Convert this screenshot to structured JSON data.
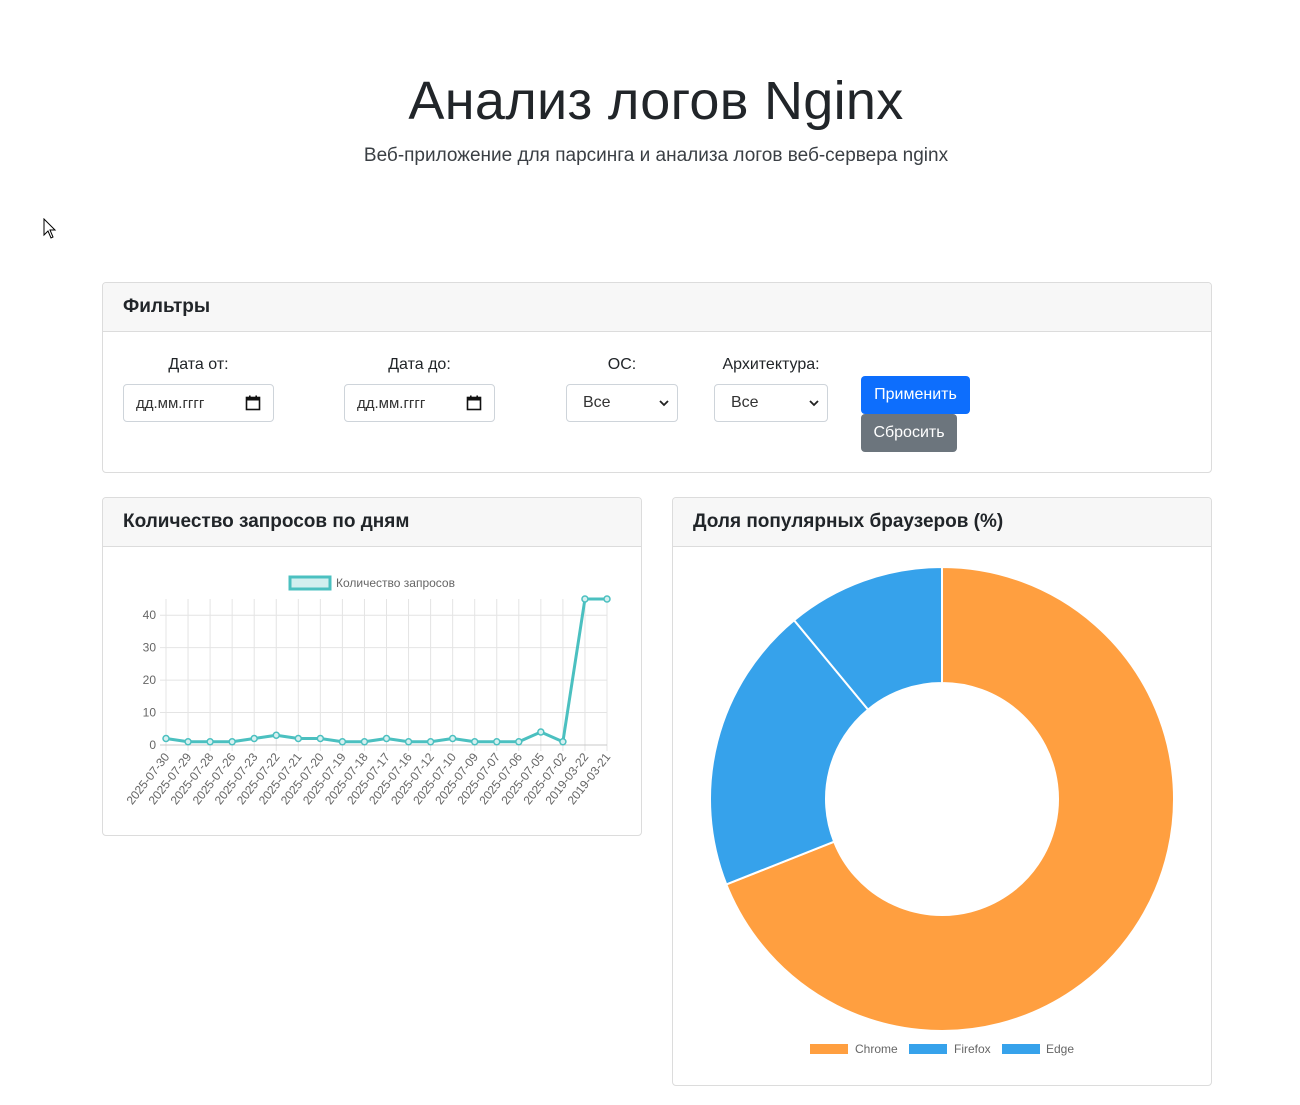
{
  "header": {
    "title": "Анализ логов Nginx",
    "subtitle": "Веб-приложение для парсинга и анализа логов веб-сервера nginx"
  },
  "filters": {
    "title": "Фильтры",
    "date_from_label": "Дата от:",
    "date_from_value": "дд.мм.гггг",
    "date_to_label": "Дата до:",
    "date_to_value": "дд.мм.гггг",
    "os_label": "ОС:",
    "os_value": "Все",
    "arch_label": "Архитектура:",
    "arch_value": "Все",
    "apply_label": "Применить",
    "reset_label": "Сбросить"
  },
  "line_card": {
    "title": "Количество запросов по дням"
  },
  "donut_card": {
    "title": "Доля популярных браузеров (%)"
  },
  "colors": {
    "primary": "#0d6efd",
    "secondary": "#6c757d",
    "line": "#4bc0c0",
    "chrome": "#ff9f40",
    "firefox": "#36a2eb",
    "edge": "#36a2eb"
  },
  "chart_data": [
    {
      "type": "line",
      "legend": [
        "Количество запросов"
      ],
      "legend_position": "top",
      "grid": true,
      "x": [
        "2025-07-30",
        "2025-07-29",
        "2025-07-28",
        "2025-07-26",
        "2025-07-23",
        "2025-07-22",
        "2025-07-21",
        "2025-07-20",
        "2025-07-19",
        "2025-07-18",
        "2025-07-17",
        "2025-07-16",
        "2025-07-12",
        "2025-07-10",
        "2025-07-09",
        "2025-07-07",
        "2025-07-06",
        "2025-07-05",
        "2025-07-02",
        "2019-03-22",
        "2019-03-21"
      ],
      "series": [
        {
          "name": "Количество запросов",
          "values": [
            2,
            1,
            1,
            1,
            2,
            3,
            2,
            2,
            1,
            1,
            2,
            1,
            1,
            2,
            1,
            1,
            1,
            4,
            1,
            45,
            45
          ]
        }
      ],
      "y_ticks": [
        0,
        10,
        20,
        30,
        40
      ],
      "ylim": [
        0,
        45
      ]
    },
    {
      "type": "pie",
      "variant": "doughnut",
      "legend_position": "bottom",
      "categories": [
        "Chrome",
        "Firefox",
        "Edge"
      ],
      "values": [
        69,
        20,
        11
      ]
    }
  ]
}
